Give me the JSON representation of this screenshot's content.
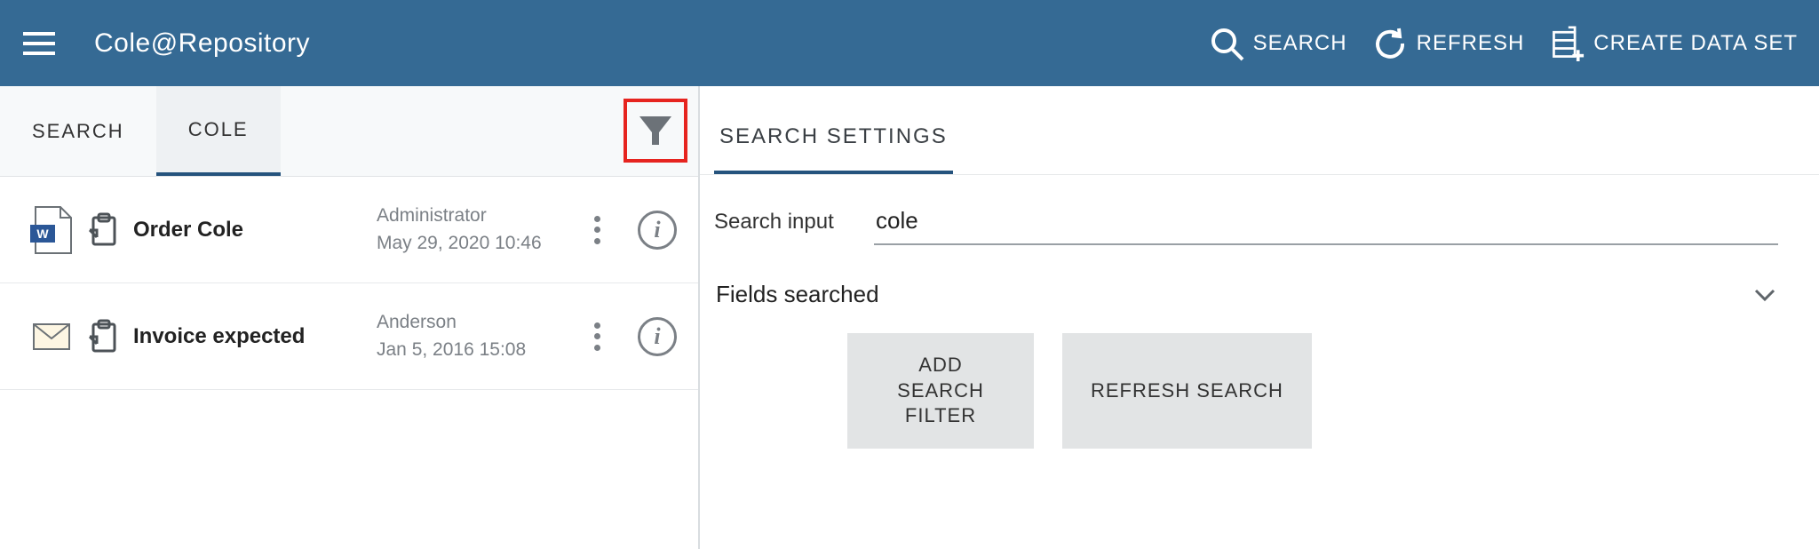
{
  "header": {
    "title": "Cole@Repository",
    "actions": {
      "search": "SEARCH",
      "refresh": "REFRESH",
      "create": "CREATE DATA SET"
    }
  },
  "left": {
    "tabs": [
      {
        "label": "SEARCH",
        "active": false
      },
      {
        "label": "COLE",
        "active": true
      }
    ],
    "results": [
      {
        "doc_type": "word",
        "title": "Order Cole",
        "user": "Administrator",
        "timestamp": "May 29, 2020 10:46"
      },
      {
        "doc_type": "mail",
        "title": "Invoice expected",
        "user": "Anderson",
        "timestamp": "Jan 5, 2016 15:08"
      }
    ]
  },
  "right": {
    "tab": "SEARCH SETTINGS",
    "search_input": {
      "label": "Search input",
      "value": "cole"
    },
    "fields_label": "Fields searched",
    "buttons": {
      "add_filter": "ADD SEARCH FILTER",
      "refresh": "REFRESH SEARCH"
    }
  }
}
